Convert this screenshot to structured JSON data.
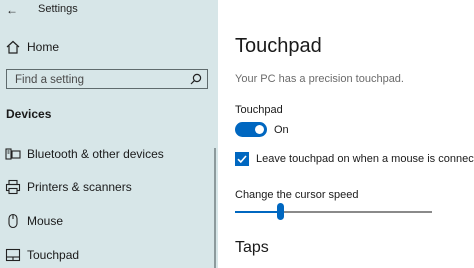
{
  "app": {
    "title": "Settings",
    "back_icon": "back-arrow-icon"
  },
  "sidebar": {
    "home": {
      "label": "Home",
      "icon": "home-icon"
    },
    "search": {
      "placeholder": "Find a setting",
      "icon": "search-icon"
    },
    "section_title": "Devices",
    "items": [
      {
        "label": "Bluetooth & other devices",
        "icon": "bluetooth-devices-icon"
      },
      {
        "label": "Printers & scanners",
        "icon": "printer-icon"
      },
      {
        "label": "Mouse",
        "icon": "mouse-icon"
      },
      {
        "label": "Touchpad",
        "icon": "touchpad-icon"
      }
    ]
  },
  "main": {
    "title": "Touchpad",
    "subtitle": "Your PC has a precision touchpad.",
    "touchpad_group_label": "Touchpad",
    "toggle": {
      "state_label": "On",
      "on": true
    },
    "checkbox": {
      "label": "Leave touchpad on when a mouse is connected",
      "checked": true
    },
    "cursor_speed": {
      "label": "Change the cursor speed",
      "level_fraction": 0.24
    },
    "taps_heading": "Taps"
  },
  "colors": {
    "accent": "#0067c0",
    "sidebar_bg": "#d7e6e8"
  }
}
